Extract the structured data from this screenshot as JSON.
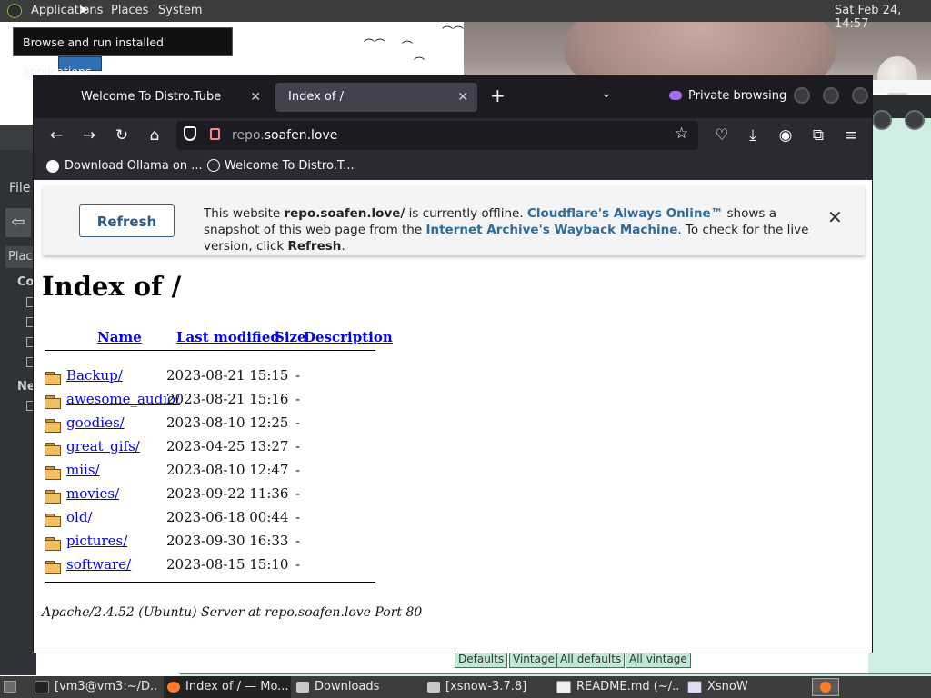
{
  "top_panel": {
    "menus": [
      "Applications",
      "Places",
      "System"
    ],
    "clock": "Sat Feb 24, 14:57",
    "tooltip": "Browse and run installed applications"
  },
  "background": {
    "left_window": {
      "menu_file": "File",
      "places": "Places",
      "section_co": "Co",
      "section_ne": "Ne"
    },
    "xsnow_buttons": [
      "Defaults",
      "Vintage",
      "All defaults",
      "All vintage"
    ]
  },
  "browser": {
    "tabs": [
      {
        "title": "Welcome To Distro.Tube",
        "active": false
      },
      {
        "title": "Index of /",
        "active": true
      }
    ],
    "new_tab": "+",
    "private_label": "Private browsing",
    "url_prefix": "repo.",
    "url_domain": "soafen.love",
    "bookmarks": [
      "Download Ollama on ...",
      "Welcome To Distro.T..."
    ],
    "banner": {
      "refresh_button": "Refresh",
      "t1": "This website ",
      "site": "repo.soafen.love/",
      "t2": " is currently offline. ",
      "link1": "Cloudflare's Always Online™",
      "t3": " shows a snapshot of this web page from the ",
      "link2": "Internet Archive's Wayback Machine",
      "t4": ". To check for the live version, click ",
      "bold_refresh": "Refresh",
      "t5": "."
    },
    "page": {
      "title": "Index of /",
      "columns": {
        "name": "Name",
        "modified": "Last modified",
        "size": "Size",
        "description": "Description"
      },
      "entries": [
        {
          "name": "Backup/",
          "modified": "2023-08-21 15:15",
          "size": "-"
        },
        {
          "name": "awesome_audio/",
          "modified": "2023-08-21 15:16",
          "size": "-"
        },
        {
          "name": "goodies/",
          "modified": "2023-08-10 12:25",
          "size": "-"
        },
        {
          "name": "great_gifs/",
          "modified": "2023-04-25 13:27",
          "size": "-"
        },
        {
          "name": "miis/",
          "modified": "2023-08-10 12:47",
          "size": "-"
        },
        {
          "name": "movies/",
          "modified": "2023-09-22 11:36",
          "size": "-"
        },
        {
          "name": "old/",
          "modified": "2023-06-18 00:44",
          "size": "-"
        },
        {
          "name": "pictures/",
          "modified": "2023-09-30 16:33",
          "size": "-"
        },
        {
          "name": "software/",
          "modified": "2023-08-15 15:10",
          "size": "-"
        }
      ],
      "footer": "Apache/2.4.52 (Ubuntu) Server at repo.soafen.love Port 80"
    }
  },
  "taskbar": {
    "items": [
      {
        "label": "[vm3@vm3:~/D...",
        "icon": "terminal-icon"
      },
      {
        "label": "Index of / — Mo...",
        "icon": "firefox-icon"
      },
      {
        "label": "Downloads",
        "icon": "folder-icon"
      },
      {
        "label": "[xsnow-3.7.8]",
        "icon": "folder-icon"
      },
      {
        "label": "README.md (~/...",
        "icon": "text-editor-icon"
      },
      {
        "label": "XsnoW",
        "icon": "window-icon"
      }
    ]
  },
  "colors": {
    "panel": "#3c3c3c",
    "browser_tabbar": "#1c1b22",
    "browser_toolbar": "#2b2a33",
    "link": "#0000ee",
    "cloudflare_link": "#2f6b9a",
    "private_purple": "#a66cff"
  }
}
